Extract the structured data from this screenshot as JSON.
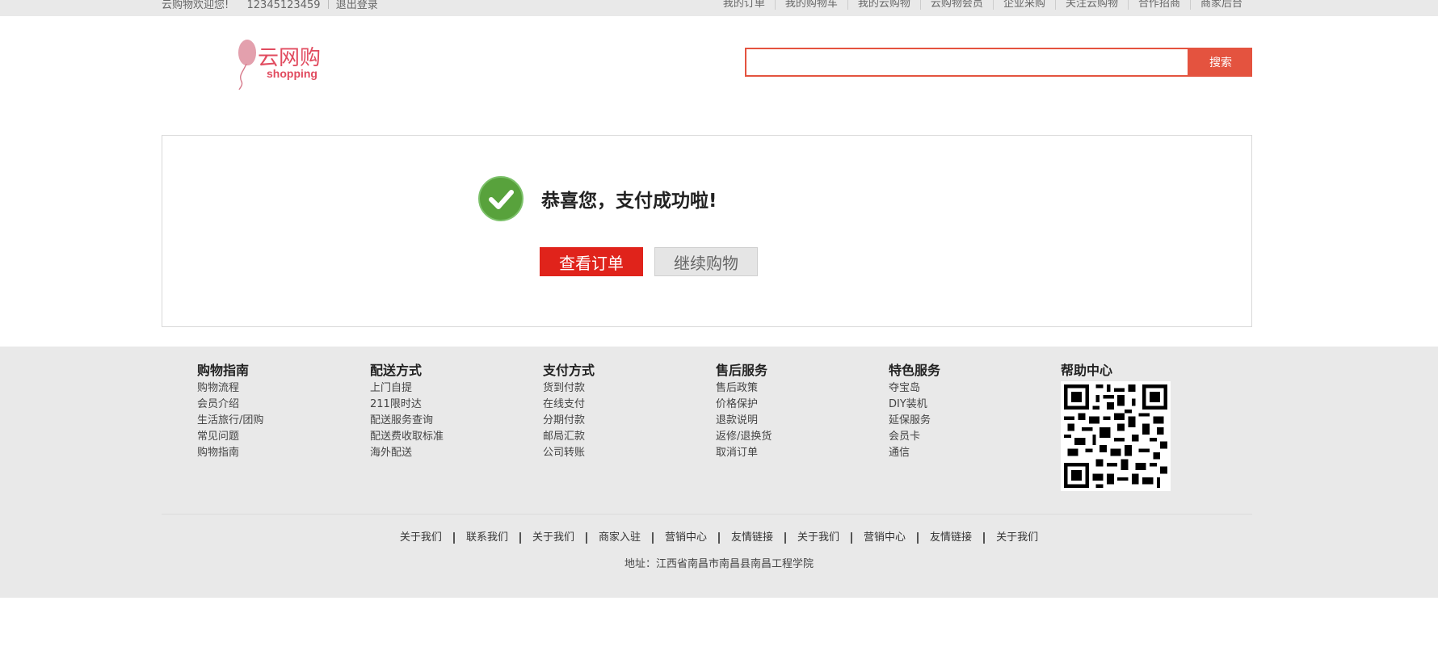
{
  "topbar": {
    "welcome": "云购物欢迎您!",
    "user": "12345123459",
    "logout": "退出登录",
    "links": [
      "我的订单",
      "我的购物车",
      "我的云购物",
      "云购物会员",
      "企业采购",
      "关注云购物",
      "合作招商",
      "商家后台"
    ]
  },
  "header": {
    "logo_text": "云网购",
    "logo_sub": "shopping",
    "search_value": "",
    "search_button": "搜索"
  },
  "success": {
    "message": "恭喜您，支付成功啦!",
    "view_order": "查看订单",
    "continue_shopping": "继续购物",
    "check_color": "#58a23c"
  },
  "footer": {
    "columns": [
      {
        "title": "购物指南",
        "items": [
          "购物流程",
          "会员介绍",
          "生活旅行/团购",
          "常见问题",
          "购物指南"
        ]
      },
      {
        "title": "配送方式",
        "items": [
          "上门自提",
          "211限时达",
          "配送服务查询",
          "配送费收取标准",
          "海外配送"
        ]
      },
      {
        "title": "支付方式",
        "items": [
          "货到付款",
          "在线支付",
          "分期付款",
          "邮局汇款",
          "公司转账"
        ]
      },
      {
        "title": "售后服务",
        "items": [
          "售后政策",
          "价格保护",
          "退款说明",
          "返修/退换货",
          "取消订单"
        ]
      },
      {
        "title": "特色服务",
        "items": [
          "夺宝岛",
          "DIY装机",
          "延保服务",
          "会员卡",
          "通信"
        ]
      },
      {
        "title": "帮助中心",
        "items": []
      }
    ],
    "bottom_links": [
      "关于我们",
      "联系我们",
      "关于我们",
      "商家入驻",
      "营销中心",
      "友情链接",
      "关于我们",
      "营销中心",
      "友情链接",
      "关于我们"
    ],
    "address": "地址：江西省南昌市南昌县南昌工程学院"
  },
  "colors": {
    "accent": "#e4533f",
    "primary_button": "#e0231b",
    "footer_bg": "#e9e9e9"
  }
}
